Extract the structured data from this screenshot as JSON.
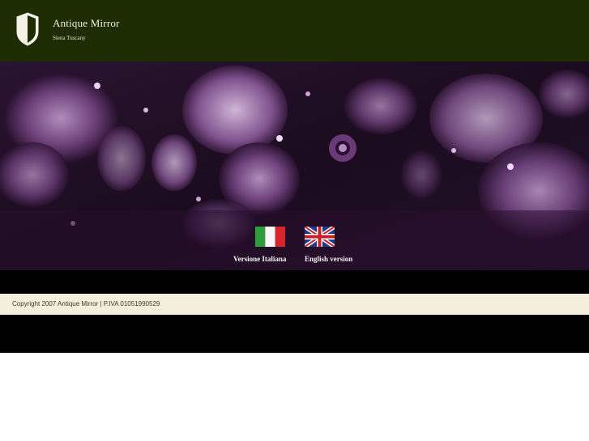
{
  "header": {
    "title": "Antique Mirror",
    "subtitle": "Siena Tuscany",
    "logo_icon": "shield-icon"
  },
  "languages": [
    {
      "label": "Versione Italiana",
      "flag": "italy-flag-icon"
    },
    {
      "label": "English version",
      "flag": "uk-flag-icon"
    }
  ],
  "footer": {
    "copyright": "Copyright 2007 Antique Mirror  |  P.IVA 01051990529"
  },
  "colors": {
    "header_bg": "#1d2c02",
    "footer_bg": "#f4eedb",
    "accent_purple": "#7a4a8a"
  }
}
